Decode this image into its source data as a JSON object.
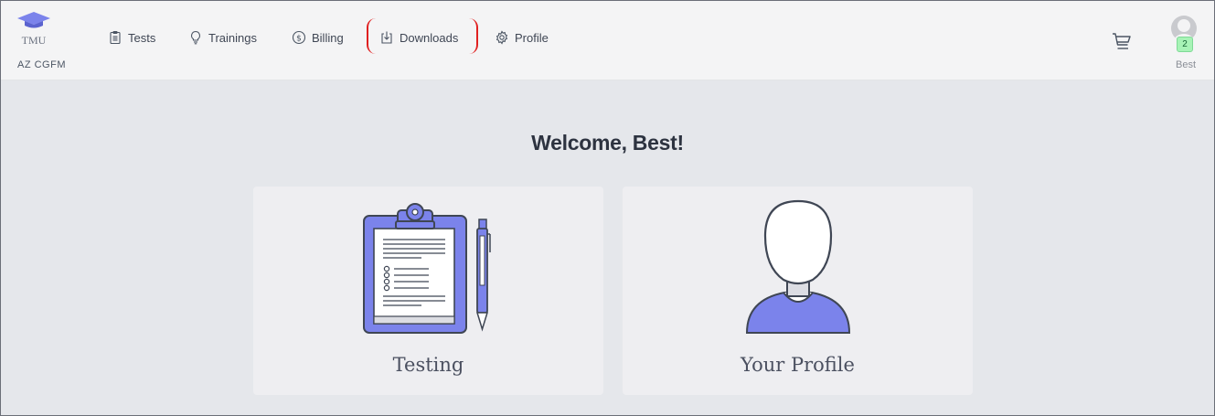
{
  "brand": {
    "logo_text": "TMU",
    "org": "AZ CGFM"
  },
  "nav": [
    {
      "label": "Tests",
      "icon": "clipboard-icon"
    },
    {
      "label": "Trainings",
      "icon": "lightbulb-icon"
    },
    {
      "label": "Billing",
      "icon": "dollar-icon"
    },
    {
      "label": "Downloads",
      "icon": "download-icon"
    },
    {
      "label": "Profile",
      "icon": "gear-icon"
    }
  ],
  "user": {
    "name": "Best",
    "notification_count": "2"
  },
  "main": {
    "welcome": "Welcome, Best!",
    "cards": [
      {
        "label": "Testing",
        "icon": "clipboard-illustration"
      },
      {
        "label": "Your Profile",
        "icon": "person-illustration"
      }
    ]
  },
  "colors": {
    "accent": "#7b83eb",
    "highlight": "#e02020",
    "background": "#e5e7eb",
    "topbar": "#f4f4f5",
    "badge": "#a7f3b6"
  }
}
